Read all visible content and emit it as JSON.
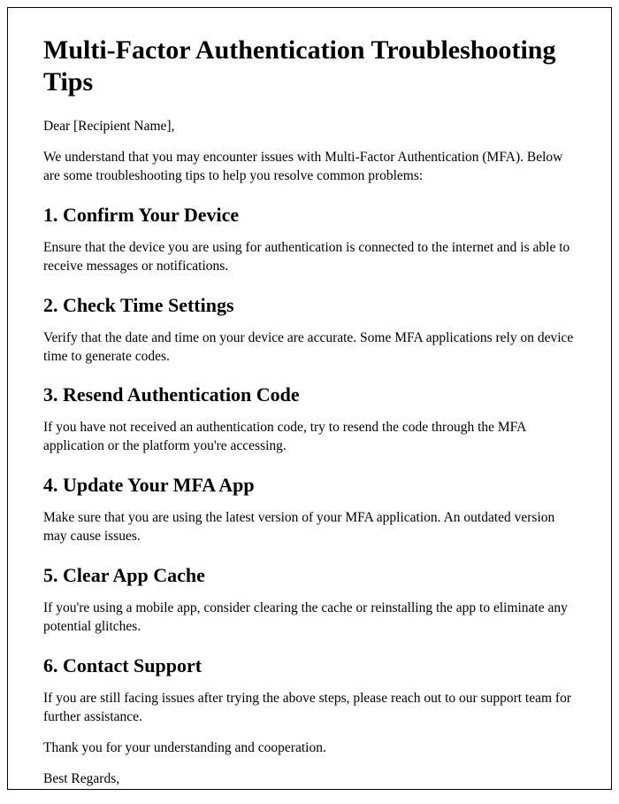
{
  "title": "Multi-Factor Authentication Troubleshooting Tips",
  "salutation": "Dear [Recipient Name],",
  "intro": "We understand that you may encounter issues with Multi-Factor Authentication (MFA). Below are some troubleshooting tips to help you resolve common problems:",
  "sections": {
    "s1": {
      "heading": "1. Confirm Your Device",
      "body": "Ensure that the device you are using for authentication is connected to the internet and is able to receive messages or notifications."
    },
    "s2": {
      "heading": "2. Check Time Settings",
      "body": "Verify that the date and time on your device are accurate. Some MFA applications rely on device time to generate codes."
    },
    "s3": {
      "heading": "3. Resend Authentication Code",
      "body": "If you have not received an authentication code, try to resend the code through the MFA application or the platform you're accessing."
    },
    "s4": {
      "heading": "4. Update Your MFA App",
      "body": "Make sure that you are using the latest version of your MFA application. An outdated version may cause issues."
    },
    "s5": {
      "heading": "5. Clear App Cache",
      "body": "If you're using a mobile app, consider clearing the cache or reinstalling the app to eliminate any potential glitches."
    },
    "s6": {
      "heading": "6. Contact Support",
      "body": "If you are still facing issues after trying the above steps, please reach out to our support team for further assistance."
    }
  },
  "thanks": "Thank you for your understanding and cooperation.",
  "closing": "Best Regards,"
}
